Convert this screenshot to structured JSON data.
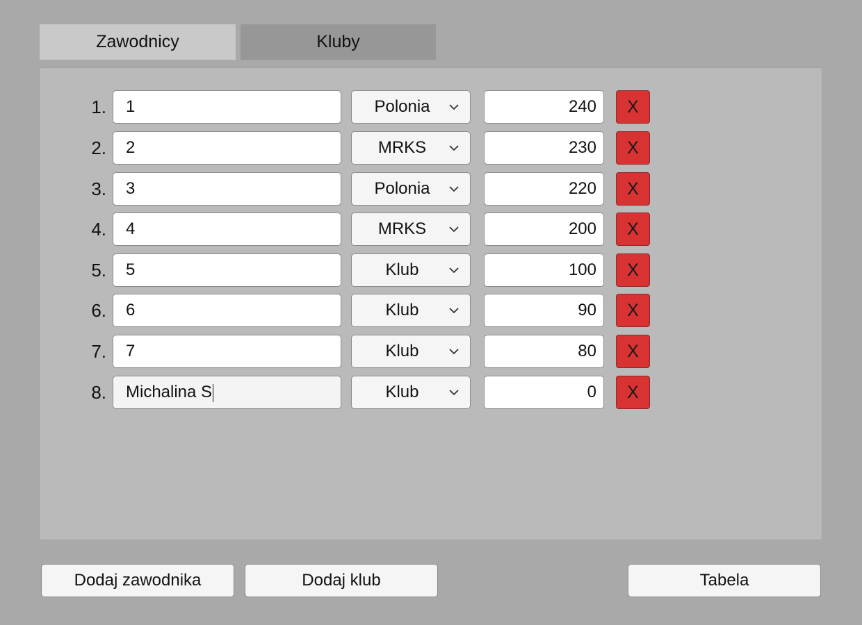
{
  "tabs": [
    {
      "label": "Zawodnicy",
      "active": true
    },
    {
      "label": "Kluby",
      "active": false
    }
  ],
  "players": [
    {
      "num": "1.",
      "name": "1",
      "club": "Polonia",
      "points": "240",
      "delete_label": "X"
    },
    {
      "num": "2.",
      "name": "2",
      "club": "MRKS",
      "points": "230",
      "delete_label": "X"
    },
    {
      "num": "3.",
      "name": "3",
      "club": "Polonia",
      "points": "220",
      "delete_label": "X"
    },
    {
      "num": "4.",
      "name": "4",
      "club": "MRKS",
      "points": "200",
      "delete_label": "X"
    },
    {
      "num": "5.",
      "name": "5",
      "club": "Klub",
      "points": "100",
      "delete_label": "X"
    },
    {
      "num": "6.",
      "name": "6",
      "club": "Klub",
      "points": "90",
      "delete_label": "X"
    },
    {
      "num": "7.",
      "name": "7",
      "club": "Klub",
      "points": "80",
      "delete_label": "X"
    },
    {
      "num": "8.",
      "name": "Michalina S",
      "club": "Klub",
      "points": "0",
      "delete_label": "X"
    }
  ],
  "footer": {
    "add_player_label": "Dodaj zawodnika",
    "add_club_label": "Dodaj klub",
    "table_label": "Tabela"
  },
  "colors": {
    "background": "#a9a9a9",
    "panel": "#bababa",
    "tab_active": "#c9c9c9",
    "tab_inactive": "#979797",
    "delete_button": "#d83232"
  },
  "icons": {
    "dropdown": "chevron-down-icon"
  }
}
